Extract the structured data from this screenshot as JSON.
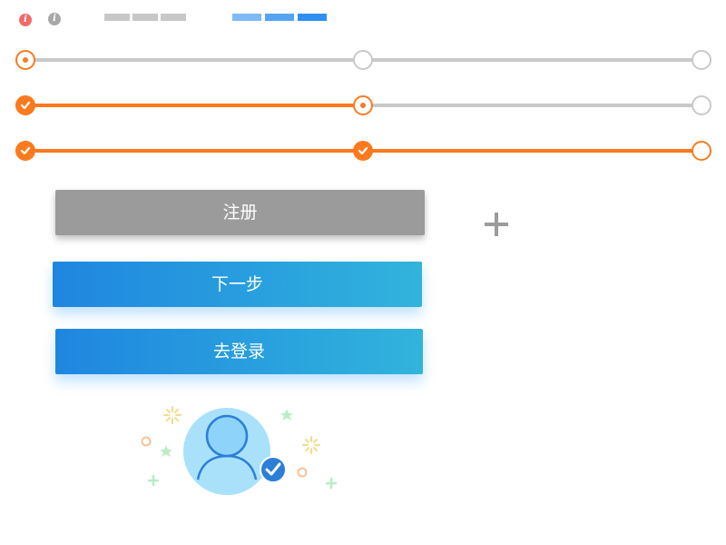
{
  "top_bar": {
    "info_icons": [
      {
        "icon": "info-icon",
        "color": "#f36a6a"
      },
      {
        "icon": "info-icon",
        "color": "#a8a8a8"
      }
    ],
    "gray_indicator_color": "#c8c8c8",
    "blue_indicator_colors": [
      "#7fbaf5",
      "#54a4f3",
      "#2f8ff0"
    ]
  },
  "steppers": [
    {
      "states": [
        "current",
        "empty",
        "empty"
      ],
      "filled_segments": 0
    },
    {
      "states": [
        "done",
        "current",
        "empty"
      ],
      "filled_segments": 1
    },
    {
      "states": [
        "done",
        "done",
        "end"
      ],
      "filled_segments": 2
    }
  ],
  "colors": {
    "accent": "#fc7a1e",
    "inactive": "#c9c9c9",
    "button_gray": "#9b9b9b",
    "button_blue_start": "#1f86e0",
    "button_blue_end": "#31b4dc"
  },
  "buttons": {
    "register_label": "注册",
    "next_label": "下一步",
    "login_label": "去登录"
  },
  "icons": {
    "add": "plus-icon",
    "avatar": "user-avatar-icon",
    "verified": "check-badge-icon"
  }
}
